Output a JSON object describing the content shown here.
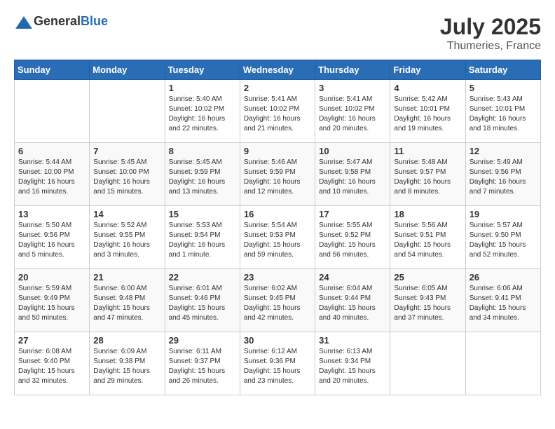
{
  "header": {
    "logo_general": "General",
    "logo_blue": "Blue",
    "month_year": "July 2025",
    "location": "Thumeries, France"
  },
  "weekdays": [
    "Sunday",
    "Monday",
    "Tuesday",
    "Wednesday",
    "Thursday",
    "Friday",
    "Saturday"
  ],
  "weeks": [
    [
      {
        "day": "",
        "content": ""
      },
      {
        "day": "",
        "content": ""
      },
      {
        "day": "1",
        "content": "Sunrise: 5:40 AM\nSunset: 10:02 PM\nDaylight: 16 hours and 22 minutes."
      },
      {
        "day": "2",
        "content": "Sunrise: 5:41 AM\nSunset: 10:02 PM\nDaylight: 16 hours and 21 minutes."
      },
      {
        "day": "3",
        "content": "Sunrise: 5:41 AM\nSunset: 10:02 PM\nDaylight: 16 hours and 20 minutes."
      },
      {
        "day": "4",
        "content": "Sunrise: 5:42 AM\nSunset: 10:01 PM\nDaylight: 16 hours and 19 minutes."
      },
      {
        "day": "5",
        "content": "Sunrise: 5:43 AM\nSunset: 10:01 PM\nDaylight: 16 hours and 18 minutes."
      }
    ],
    [
      {
        "day": "6",
        "content": "Sunrise: 5:44 AM\nSunset: 10:00 PM\nDaylight: 16 hours and 16 minutes."
      },
      {
        "day": "7",
        "content": "Sunrise: 5:45 AM\nSunset: 10:00 PM\nDaylight: 16 hours and 15 minutes."
      },
      {
        "day": "8",
        "content": "Sunrise: 5:45 AM\nSunset: 9:59 PM\nDaylight: 16 hours and 13 minutes."
      },
      {
        "day": "9",
        "content": "Sunrise: 5:46 AM\nSunset: 9:59 PM\nDaylight: 16 hours and 12 minutes."
      },
      {
        "day": "10",
        "content": "Sunrise: 5:47 AM\nSunset: 9:58 PM\nDaylight: 16 hours and 10 minutes."
      },
      {
        "day": "11",
        "content": "Sunrise: 5:48 AM\nSunset: 9:57 PM\nDaylight: 16 hours and 8 minutes."
      },
      {
        "day": "12",
        "content": "Sunrise: 5:49 AM\nSunset: 9:56 PM\nDaylight: 16 hours and 7 minutes."
      }
    ],
    [
      {
        "day": "13",
        "content": "Sunrise: 5:50 AM\nSunset: 9:56 PM\nDaylight: 16 hours and 5 minutes."
      },
      {
        "day": "14",
        "content": "Sunrise: 5:52 AM\nSunset: 9:55 PM\nDaylight: 16 hours and 3 minutes."
      },
      {
        "day": "15",
        "content": "Sunrise: 5:53 AM\nSunset: 9:54 PM\nDaylight: 16 hours and 1 minute."
      },
      {
        "day": "16",
        "content": "Sunrise: 5:54 AM\nSunset: 9:53 PM\nDaylight: 15 hours and 59 minutes."
      },
      {
        "day": "17",
        "content": "Sunrise: 5:55 AM\nSunset: 9:52 PM\nDaylight: 15 hours and 56 minutes."
      },
      {
        "day": "18",
        "content": "Sunrise: 5:56 AM\nSunset: 9:51 PM\nDaylight: 15 hours and 54 minutes."
      },
      {
        "day": "19",
        "content": "Sunrise: 5:57 AM\nSunset: 9:50 PM\nDaylight: 15 hours and 52 minutes."
      }
    ],
    [
      {
        "day": "20",
        "content": "Sunrise: 5:59 AM\nSunset: 9:49 PM\nDaylight: 15 hours and 50 minutes."
      },
      {
        "day": "21",
        "content": "Sunrise: 6:00 AM\nSunset: 9:48 PM\nDaylight: 15 hours and 47 minutes."
      },
      {
        "day": "22",
        "content": "Sunrise: 6:01 AM\nSunset: 9:46 PM\nDaylight: 15 hours and 45 minutes."
      },
      {
        "day": "23",
        "content": "Sunrise: 6:02 AM\nSunset: 9:45 PM\nDaylight: 15 hours and 42 minutes."
      },
      {
        "day": "24",
        "content": "Sunrise: 6:04 AM\nSunset: 9:44 PM\nDaylight: 15 hours and 40 minutes."
      },
      {
        "day": "25",
        "content": "Sunrise: 6:05 AM\nSunset: 9:43 PM\nDaylight: 15 hours and 37 minutes."
      },
      {
        "day": "26",
        "content": "Sunrise: 6:06 AM\nSunset: 9:41 PM\nDaylight: 15 hours and 34 minutes."
      }
    ],
    [
      {
        "day": "27",
        "content": "Sunrise: 6:08 AM\nSunset: 9:40 PM\nDaylight: 15 hours and 32 minutes."
      },
      {
        "day": "28",
        "content": "Sunrise: 6:09 AM\nSunset: 9:38 PM\nDaylight: 15 hours and 29 minutes."
      },
      {
        "day": "29",
        "content": "Sunrise: 6:11 AM\nSunset: 9:37 PM\nDaylight: 15 hours and 26 minutes."
      },
      {
        "day": "30",
        "content": "Sunrise: 6:12 AM\nSunset: 9:36 PM\nDaylight: 15 hours and 23 minutes."
      },
      {
        "day": "31",
        "content": "Sunrise: 6:13 AM\nSunset: 9:34 PM\nDaylight: 15 hours and 20 minutes."
      },
      {
        "day": "",
        "content": ""
      },
      {
        "day": "",
        "content": ""
      }
    ]
  ]
}
